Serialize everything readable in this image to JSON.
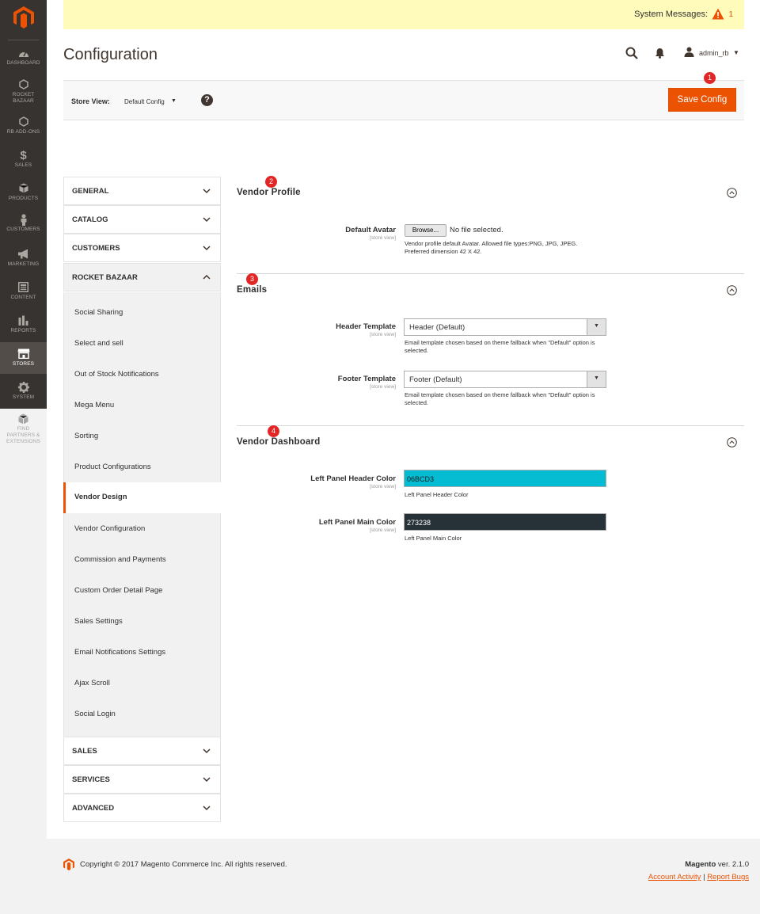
{
  "nav": {
    "items": [
      {
        "label": "DASHBOARD",
        "icon": "dashboard-icon"
      },
      {
        "label": "ROCKET BAZAAR",
        "icon": "hexagon-icon"
      },
      {
        "label": "RB ADD-ONS",
        "icon": "hexagon-icon"
      },
      {
        "label": "SALES",
        "icon": "dollar-icon"
      },
      {
        "label": "PRODUCTS",
        "icon": "cube-icon"
      },
      {
        "label": "CUSTOMERS",
        "icon": "person-icon"
      },
      {
        "label": "MARKETING",
        "icon": "megaphone-icon"
      },
      {
        "label": "CONTENT",
        "icon": "content-icon"
      },
      {
        "label": "REPORTS",
        "icon": "bar-chart-icon"
      },
      {
        "label": "STORES",
        "icon": "store-icon"
      },
      {
        "label": "SYSTEM",
        "icon": "gear-icon"
      },
      {
        "label": "FIND PARTNERS & EXTENSIONS",
        "icon": "cube-icon"
      }
    ],
    "active": "STORES"
  },
  "system_messages": {
    "label": "System Messages:",
    "count": "1"
  },
  "page": {
    "title": "Configuration"
  },
  "header": {
    "username": "admin_rb"
  },
  "scope": {
    "label": "Store View:",
    "value": "Default Config",
    "help": "?"
  },
  "save_button": "Save Config",
  "badges": [
    "1",
    "2",
    "3",
    "4"
  ],
  "tabs_top": [
    "GENERAL",
    "CATALOG",
    "CUSTOMERS",
    "ROCKET BAZAAR"
  ],
  "subitems": [
    "Social Sharing",
    "Select and sell",
    "Out of Stock Notifications",
    "Mega Menu",
    "Sorting",
    "Product Configurations",
    "Vendor Design",
    "Vendor Configuration",
    "Commission and Payments",
    "Custom Order Detail Page",
    "Sales Settings",
    "Email Notifications Settings",
    "Ajax Scroll",
    "Social Login"
  ],
  "active_subitem": "Vendor Design",
  "tabs_bottom": [
    "SALES",
    "SERVICES",
    "ADVANCED"
  ],
  "sections": {
    "vendor_profile": {
      "title": "Vendor Profile",
      "avatar_label": "Default Avatar",
      "scope": "[store view]",
      "browse": "Browse...",
      "no_file": "No file selected.",
      "note": "Vendor profile default Avatar. Allowed file types:PNG, JPG, JPEG. Preferred dimension 42 X 42."
    },
    "emails": {
      "title": "Emails",
      "header_label": "Header Template",
      "header_value": "Header (Default)",
      "header_scope": "[store view]",
      "header_note": "Email template chosen based on theme fallback when \"Default\" option is selected.",
      "footer_label": "Footer Template",
      "footer_value": "Footer (Default)",
      "footer_scope": "[store view]",
      "footer_note": "Email template chosen based on theme fallback when \"Default\" option is selected."
    },
    "vendor_dashboard": {
      "title": "Vendor Dashboard",
      "header_color_label": "Left Panel Header Color",
      "header_color_scope": "[store view]",
      "header_color_value": "06BCD3",
      "header_color_note": "Left Panel Header Color",
      "main_color_label": "Left Panel Main Color",
      "main_color_scope": "[store view]",
      "main_color_value": "273238",
      "main_color_note": "Left Panel Main Color"
    }
  },
  "footer": {
    "copyright": "Copyright © 2017 Magento Commerce Inc. All rights reserved.",
    "brand": "Magento",
    "version": " ver. 2.1.0",
    "account_activity": "Account Activity",
    "separator": " | ",
    "report_bugs": "Report Bugs"
  },
  "colors": {
    "accent": "#eb5202",
    "sidebar": "#373330",
    "header_color": "#06BCD3",
    "main_color": "#273238"
  }
}
